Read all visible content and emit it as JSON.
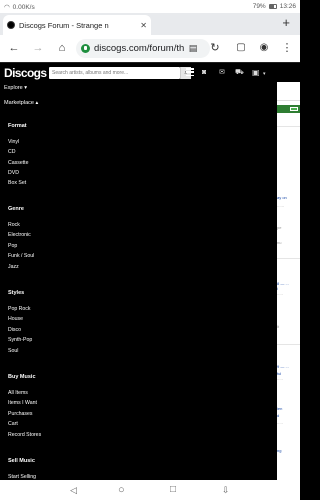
{
  "status_bar": {
    "speed": "0.00K/s",
    "battery": "79%",
    "time": "13:26"
  },
  "browser": {
    "tab_title": "Discogs Forum - Strange n",
    "tab_close": "✕",
    "new_tab": "+",
    "url": "discogs.com/forum/th"
  },
  "header": {
    "logo": "Discogs",
    "search_placeholder": "Search artists, albums and more..."
  },
  "menu": {
    "explore": "Explore",
    "marketplace": "Marketplace",
    "format_heading": "Format",
    "format_items": [
      "Vinyl",
      "CD",
      "Cassette",
      "DVD",
      "Box Set"
    ],
    "genre_heading": "Genre",
    "genre_items": [
      "Rock",
      "Electronic",
      "Pop",
      "Funk / Soul",
      "Jazz"
    ],
    "styles_heading": "Styles",
    "styles_items": [
      "Pop Rock",
      "House",
      "Disco",
      "Synth-Pop",
      "Soul"
    ],
    "buy_heading": "Buy Music",
    "buy_items": [
      "All Items",
      "Items I Want",
      "Purchases",
      "Cart",
      "Record Stores"
    ],
    "sell_heading": "Sell Music",
    "sell_items": [
      "Start Selling"
    ]
  },
  "page_behind": {
    "links": [
      "ay on",
      "pe",
      "nu",
      "8 — ...",
      "i",
      "lt",
      "9 — ...",
      "ful",
      "ien",
      "d",
      "ng"
    ]
  }
}
